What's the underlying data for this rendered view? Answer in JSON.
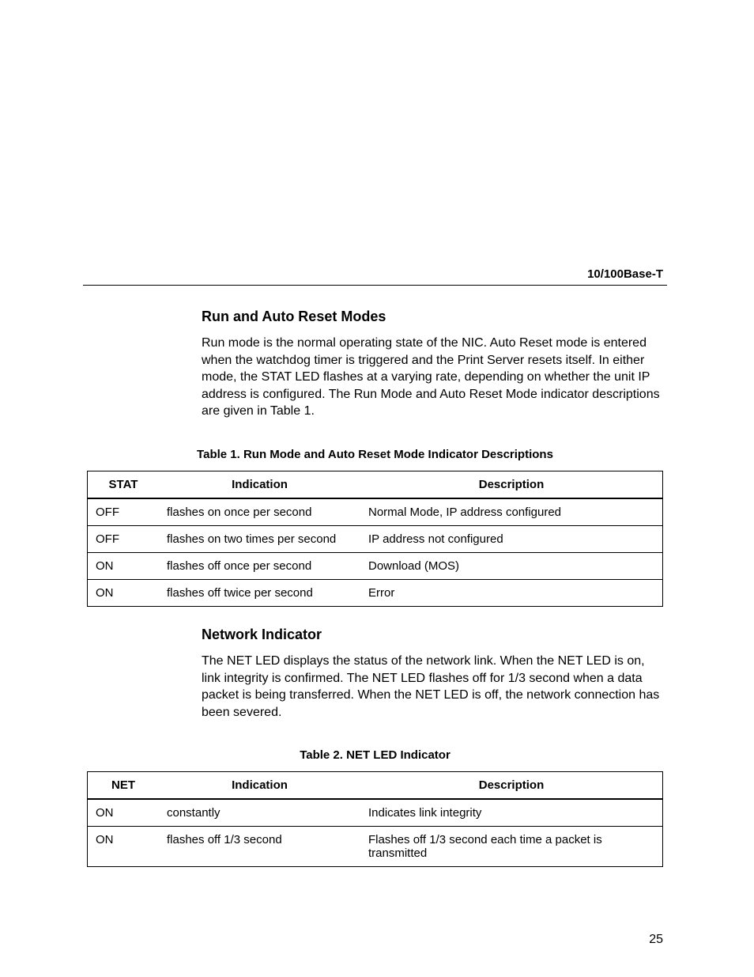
{
  "header": {
    "label": "10/100Base-T"
  },
  "section1": {
    "heading": "Run and Auto Reset Modes",
    "body": "Run mode is the normal operating state of the NIC. Auto Reset mode is entered when the watchdog timer is triggered and the Print Server resets itself. In either mode, the STAT LED flashes at a varying rate, depending on whether the unit IP address is configured. The Run Mode and Auto Reset Mode indicator descriptions are given in Table 1."
  },
  "table1": {
    "caption": "Table 1. Run Mode and Auto Reset Mode Indicator Descriptions",
    "headers": {
      "c1": "STAT",
      "c2": "Indication",
      "c3": "Description"
    },
    "rows": [
      {
        "c1": "OFF",
        "c2": "flashes on once per second",
        "c3": "Normal Mode, IP address configured"
      },
      {
        "c1": "OFF",
        "c2": "flashes on two times per second",
        "c3": "IP address not configured"
      },
      {
        "c1": "ON",
        "c2": "flashes off once per second",
        "c3": "Download (MOS)"
      },
      {
        "c1": "ON",
        "c2": "flashes off twice per second",
        "c3": "Error"
      }
    ]
  },
  "section2": {
    "heading": "Network Indicator",
    "body": "The NET LED displays the status of the network link. When the NET LED is on, link integrity is confirmed. The NET LED flashes off for 1/3 second when a data packet is being transferred. When the NET LED is off, the network connection has been severed."
  },
  "table2": {
    "caption": "Table 2. NET LED Indicator",
    "headers": {
      "c1": "NET",
      "c2": "Indication",
      "c3": "Description"
    },
    "rows": [
      {
        "c1": "ON",
        "c2": "constantly",
        "c3": "Indicates link integrity"
      },
      {
        "c1": "ON",
        "c2": "flashes off 1/3 second",
        "c3": "Flashes off 1/3 second each time a packet is transmitted"
      }
    ]
  },
  "pageNumber": "25"
}
